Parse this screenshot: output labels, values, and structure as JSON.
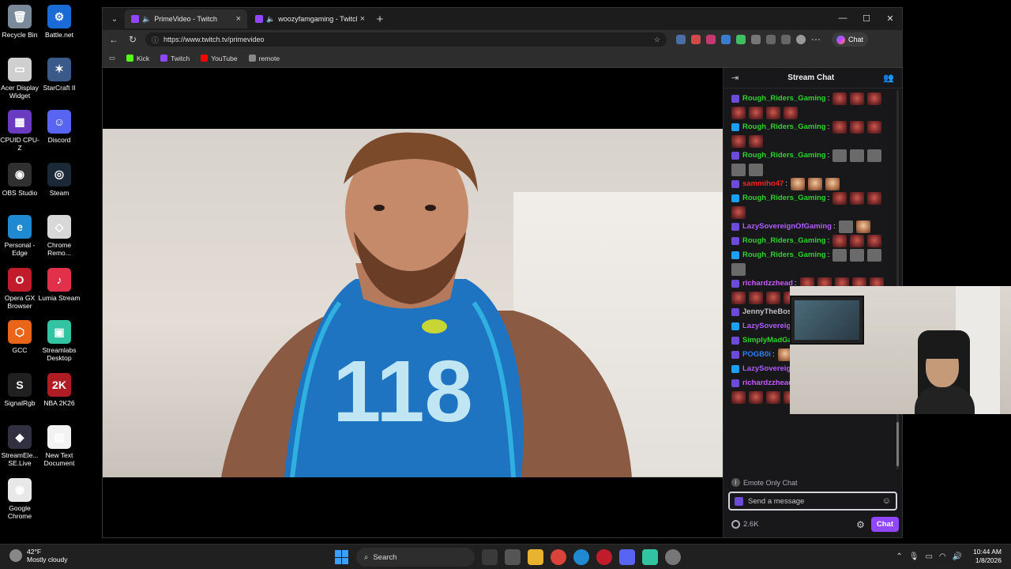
{
  "desktop": {
    "icons": [
      {
        "label": "Recycle Bin",
        "color": "#7a8a9a",
        "glyph": "🗑"
      },
      {
        "label": "Battle.net",
        "color": "#1a6bd6",
        "glyph": "⚙"
      },
      {
        "label": "Acer Display Widget",
        "color": "#cfcfcf",
        "glyph": "▭"
      },
      {
        "label": "StarCraft II",
        "color": "#3a5a8a",
        "glyph": "✶"
      },
      {
        "label": "CPUID CPU-Z",
        "color": "#6a3ac0",
        "glyph": "▦"
      },
      {
        "label": "Discord",
        "color": "#5865f2",
        "glyph": "☺"
      },
      {
        "label": "OBS Studio",
        "color": "#303030",
        "glyph": "◉"
      },
      {
        "label": "Steam",
        "color": "#1b2838",
        "glyph": "◎"
      },
      {
        "label": "Personal - Edge",
        "color": "#1f8ad2",
        "glyph": "e"
      },
      {
        "label": "Chrome Remo...",
        "color": "#d8d8d8",
        "glyph": "◇"
      },
      {
        "label": "Opera GX Browser",
        "color": "#c01c2c",
        "glyph": "O"
      },
      {
        "label": "Lumia Stream",
        "color": "#e0304a",
        "glyph": "♪"
      },
      {
        "label": "GCC",
        "color": "#e8651a",
        "glyph": "⬡"
      },
      {
        "label": "Streamlabs Desktop",
        "color": "#31c3a2",
        "glyph": "▣"
      },
      {
        "label": "SignalRgb",
        "color": "#202020",
        "glyph": "S"
      },
      {
        "label": "NBA 2K26",
        "color": "#b01c24",
        "glyph": "2K"
      },
      {
        "label": "StreamEle... SE.Live",
        "color": "#303040",
        "glyph": "◆"
      },
      {
        "label": "New Text Document",
        "color": "#f2f2f2",
        "glyph": "▤"
      },
      {
        "label": "Google Chrome",
        "color": "#e8e8e8",
        "glyph": "◉"
      }
    ]
  },
  "browser": {
    "tabs": [
      {
        "title": "PrimeVideo - Twitch",
        "active": true
      },
      {
        "title": "woozyfamgaming - Twitch",
        "active": false
      }
    ],
    "url": "https://www.twitch.tv/primevideo",
    "chat_button": "Chat",
    "bookmarks": [
      {
        "label": "Kick",
        "color": "#53fc18"
      },
      {
        "label": "Twitch",
        "color": "#9146ff"
      },
      {
        "label": "YouTube",
        "color": "#ff0000"
      },
      {
        "label": "remote",
        "color": "#888888"
      }
    ]
  },
  "stream_chat": {
    "title": "Stream Chat",
    "messages": [
      {
        "user": "Rough_Riders_Gaming",
        "color": "#2fd32f",
        "emotes": [
          "red",
          "red",
          "red",
          "red",
          "red",
          "red",
          "red"
        ]
      },
      {
        "user": "Rough_Riders_Gaming",
        "color": "#2fd32f",
        "emotes": [
          "red",
          "red",
          "red",
          "red",
          "red"
        ]
      },
      {
        "user": "Rough_Riders_Gaming",
        "color": "#2fd32f",
        "emotes": [
          "gray",
          "gray",
          "gray",
          "gray",
          "gray"
        ]
      },
      {
        "user": "sammiho47",
        "color": "#ff2020",
        "emotes": [
          "face",
          "face",
          "face"
        ]
      },
      {
        "user": "Rough_Riders_Gaming",
        "color": "#2fd32f",
        "emotes": [
          "red",
          "red",
          "red",
          "red"
        ]
      },
      {
        "user": "LazySovereignOfGaming",
        "color": "#b05cff",
        "emotes": [
          "gray",
          "face"
        ]
      },
      {
        "user": "Rough_Riders_Gaming",
        "color": "#2fd32f",
        "emotes": [
          "red",
          "red",
          "red"
        ]
      },
      {
        "user": "Rough_Riders_Gaming",
        "color": "#2fd32f",
        "emotes": [
          "gray",
          "gray",
          "gray",
          "gray"
        ]
      },
      {
        "user": "richardzzhead",
        "color": "#c85cff",
        "emotes": [
          "red",
          "red",
          "red",
          "red",
          "red",
          "red",
          "red",
          "red",
          "red",
          "red"
        ]
      },
      {
        "user": "JennyTheBos",
        "color": "#c0c0c0",
        "emotes": [
          "red",
          "red",
          "red",
          "red"
        ]
      },
      {
        "user": "LazySovereig",
        "color": "#b05cff",
        "emotes": [
          "gray"
        ]
      },
      {
        "user": "SimplyMadGami",
        "color": "#2fd32f",
        "emotes": [
          "gray"
        ]
      },
      {
        "user": "POGB0i",
        "color": "#2f7fff",
        "emotes": [
          "face"
        ]
      },
      {
        "user": "LazySovereignOfGaming",
        "color": "#b05cff",
        "emotes": [
          "gray",
          "gray",
          "gray"
        ]
      },
      {
        "user": "richardzzhead",
        "color": "#c85cff",
        "emotes": [
          "red",
          "red",
          "red",
          "red",
          "red",
          "red",
          "red",
          "red",
          "red",
          "red",
          "red",
          "red"
        ]
      }
    ],
    "emote_only": "Emote Only Chat",
    "send_placeholder": "Send a message",
    "points": "2.6K",
    "chat_button": "Chat"
  },
  "taskbar": {
    "weather_temp": "42°F",
    "weather_desc": "Mostly cloudy",
    "search": "Search",
    "time": "10:44 AM",
    "date": "1/8/2026"
  }
}
